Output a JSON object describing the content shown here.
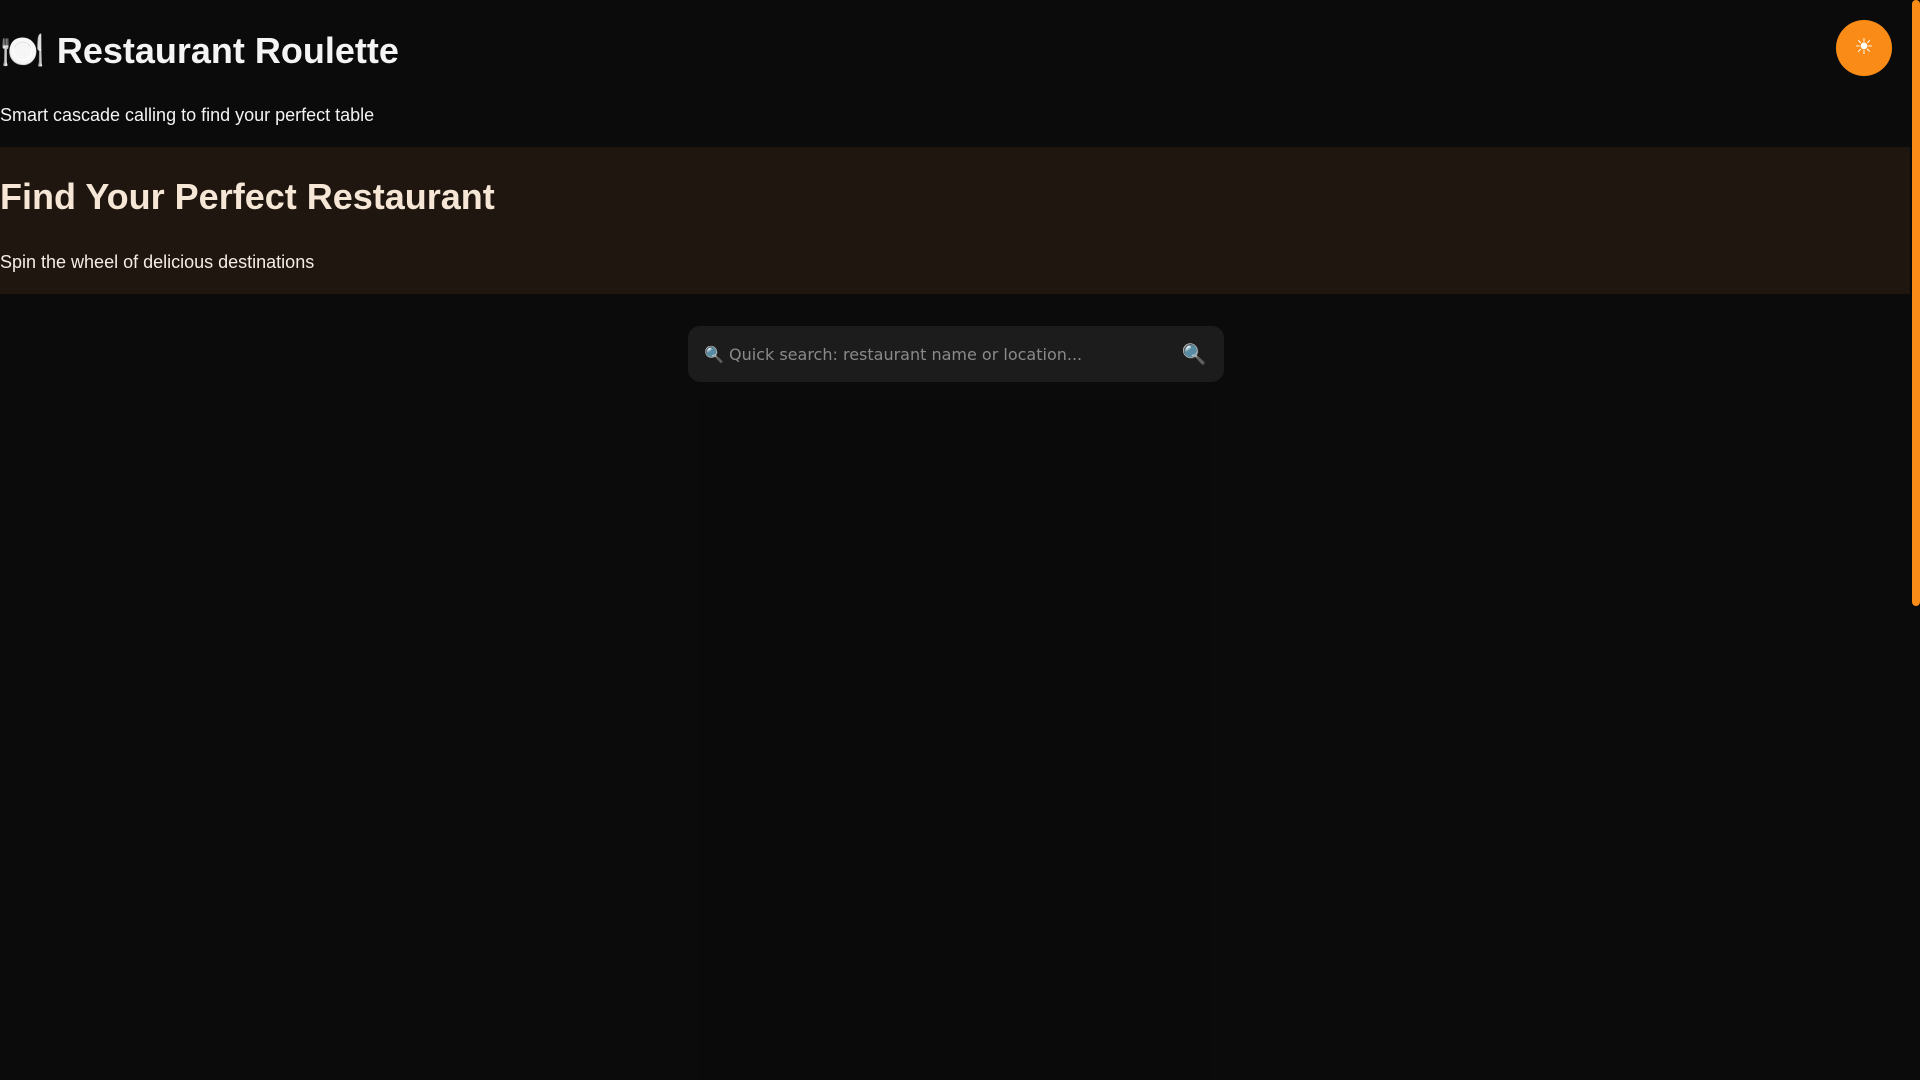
{
  "header": {
    "title_emoji": "🍽️",
    "title": "Restaurant Roulette",
    "subtitle": "Smart cascade calling to find your perfect table",
    "theme_toggle_icon": "☀"
  },
  "hero": {
    "title": "Find Your Perfect Restaurant",
    "subtitle": "Spin the wheel of delicious destinations"
  },
  "search": {
    "placeholder": "🔍 Quick search: restaurant name or location...",
    "button_icon": "🔍"
  },
  "colors": {
    "accent": "#f98b16",
    "background": "#0b0b0b",
    "hero_background": "#201610",
    "search_background": "#1c1c1c"
  },
  "icons": {
    "title_icon": "plate-cutlery-icon",
    "theme_icon": "sun-icon",
    "search_icon": "search-icon"
  }
}
